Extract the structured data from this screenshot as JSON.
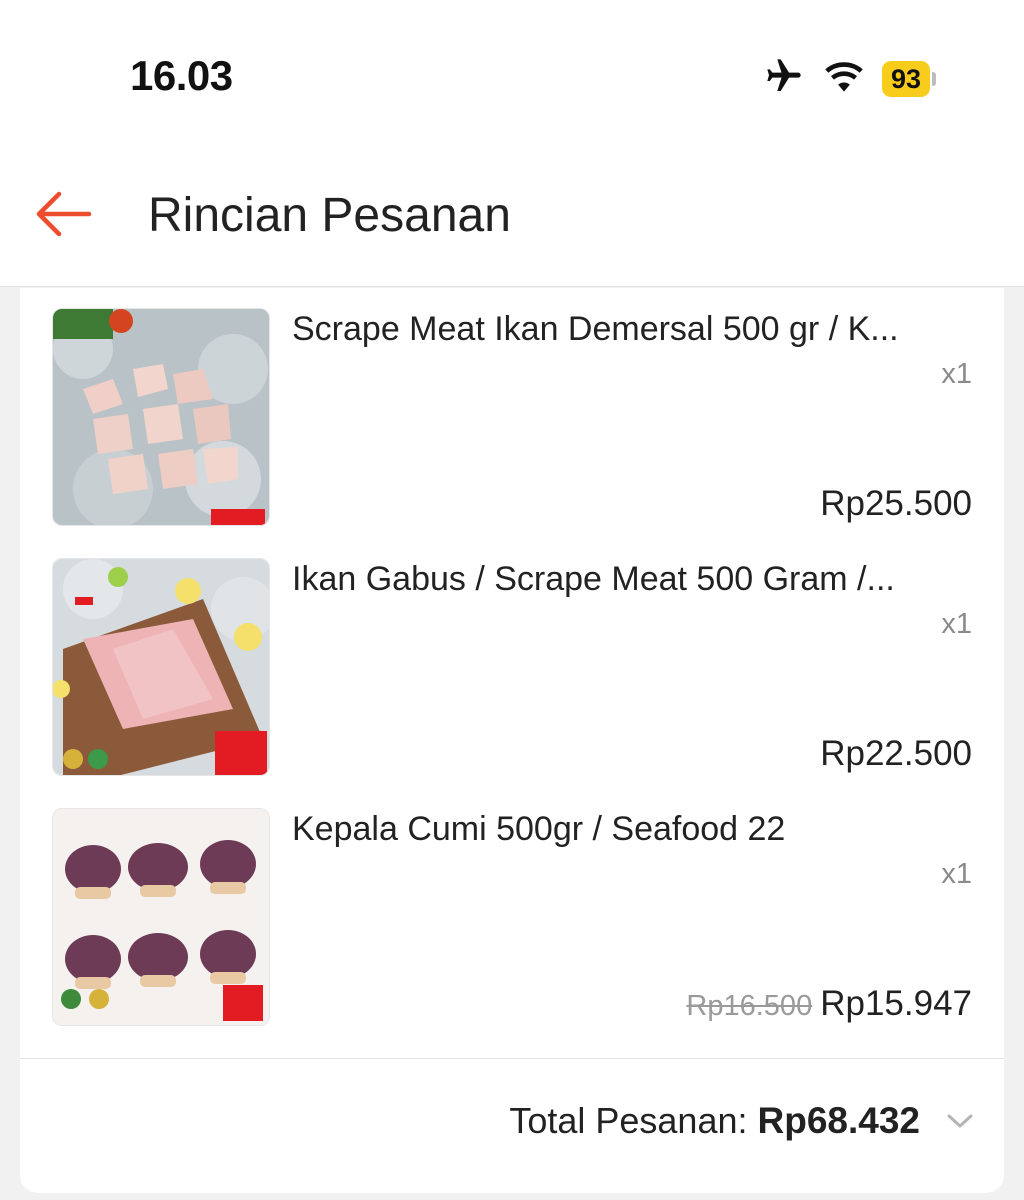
{
  "status_bar": {
    "time": "16.03",
    "battery": "93",
    "icons": [
      "airplane-icon",
      "wifi-icon",
      "battery-icon"
    ]
  },
  "header": {
    "title": "Rincian Pesanan",
    "back_icon": "back-arrow-icon",
    "accent_color": "#ee4d2d"
  },
  "items": [
    {
      "name": "Scrape Meat Ikan Demersal 500 gr / K...",
      "quantity": "x1",
      "original_price": "",
      "price": "Rp25.500"
    },
    {
      "name": "Ikan Gabus / Scrape Meat 500 Gram /...",
      "quantity": "x1",
      "original_price": "",
      "price": "Rp22.500"
    },
    {
      "name": "Kepala Cumi 500gr / Seafood 22",
      "quantity": "x1",
      "original_price": "Rp16.500",
      "price": "Rp15.947"
    }
  ],
  "total": {
    "label": "Total Pesanan:",
    "value": "Rp68.432",
    "expand_icon": "chevron-down-icon"
  }
}
